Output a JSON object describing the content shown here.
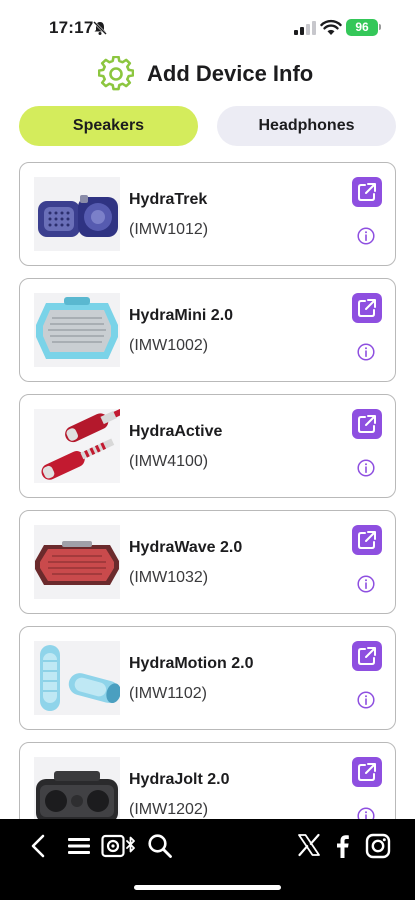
{
  "status_bar": {
    "time": "17:17",
    "battery": "96",
    "icons": [
      "bell-muted-icon",
      "cellular-signal-icon",
      "wifi-icon",
      "battery-icon"
    ]
  },
  "header": {
    "title": "Add Device Info",
    "icon": "gear-icon",
    "accent_color": "#8cc63f"
  },
  "tabs": [
    {
      "label": "Speakers",
      "active": true,
      "color": "#d4ec5c"
    },
    {
      "label": "Headphones",
      "active": false,
      "color": "#ececf4"
    }
  ],
  "devices": [
    {
      "name": "HydraTrek",
      "model": "(IMW1012)",
      "image": "hydratrek-speaker-image"
    },
    {
      "name": "HydraMini 2.0",
      "model": "(IMW1002)",
      "image": "hydramini-speaker-image"
    },
    {
      "name": "HydraActive",
      "model": "(IMW4100)",
      "image": "hydraactive-speaker-image"
    },
    {
      "name": "HydraWave 2.0",
      "model": "(IMW1032)",
      "image": "hydrawave-speaker-image"
    },
    {
      "name": "HydraMotion 2.0",
      "model": "(IMW1102)",
      "image": "hydramotion-speaker-image"
    },
    {
      "name": "HydraJolt 2.0",
      "model": "(IMW1202)",
      "image": "hydrajolt-speaker-image"
    }
  ],
  "card_actions": {
    "open_icon": "open-external-icon",
    "info_icon": "info-icon",
    "accent_color": "#8e4fe0"
  },
  "bottom_bar": {
    "left_icons": [
      "back-chevron-icon",
      "menu-icon",
      "speaker-bluetooth-icon",
      "search-icon"
    ],
    "right_icons": [
      "x-logo-icon",
      "facebook-icon",
      "instagram-icon"
    ]
  }
}
